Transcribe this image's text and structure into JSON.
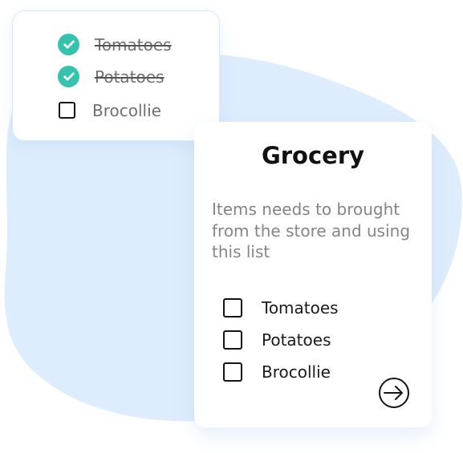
{
  "colors": {
    "blob": "#deedfd",
    "check": "#35c3ae",
    "card": "#ffffff"
  },
  "preview_card": {
    "items": [
      {
        "label": "Tomatoes",
        "checked": true,
        "icon": "check-circle-icon"
      },
      {
        "label": "Potatoes",
        "checked": true,
        "icon": "check-circle-icon"
      },
      {
        "label": "Brocollie",
        "checked": false,
        "icon": "checkbox-icon"
      }
    ]
  },
  "grocery_card": {
    "title": "Grocery",
    "description": "Items needs to brought from the store and using this list",
    "items": [
      {
        "label": "Tomatoes",
        "checked": false
      },
      {
        "label": "Potatoes",
        "checked": false
      },
      {
        "label": "Brocollie",
        "checked": false
      }
    ],
    "action_icon": "arrow-right-circle-icon"
  }
}
